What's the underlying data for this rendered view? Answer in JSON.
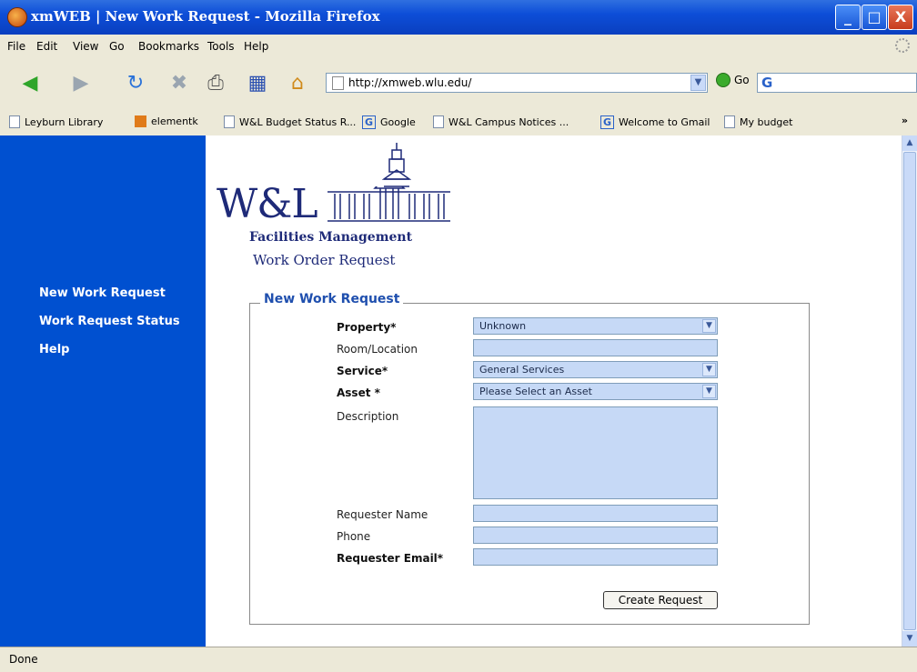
{
  "window": {
    "title": "xmWEB | New Work Request - Mozilla Firefox",
    "minimize_glyph": "_",
    "maximize_glyph": "□",
    "close_glyph": "X"
  },
  "menubar": {
    "items": [
      "File",
      "Edit",
      "View",
      "Go",
      "Bookmarks",
      "Tools",
      "Help"
    ]
  },
  "navbar": {
    "url": "http://xmweb.wlu.edu/",
    "go_label": "Go",
    "icons": [
      "back-icon",
      "forward-icon",
      "reload-icon",
      "stop-icon",
      "print-icon",
      "bookmarks-icon",
      "home-icon"
    ]
  },
  "bookmarks": {
    "items": [
      {
        "label": "Leyburn Library",
        "icon": "page"
      },
      {
        "label": "elementk",
        "icon": "elementk"
      },
      {
        "label": "W&L Budget Status R...",
        "icon": "page"
      },
      {
        "label": "Google",
        "icon": "google"
      },
      {
        "label": "W&L Campus Notices ...",
        "icon": "page"
      },
      {
        "label": "Welcome to Gmail",
        "icon": "google"
      },
      {
        "label": "My budget",
        "icon": "page"
      }
    ],
    "more": "»"
  },
  "sidebar": {
    "links": [
      "New Work Request",
      "Work Request Status",
      "Help"
    ]
  },
  "logo": {
    "wordmark": "W&L",
    "line1": "Facilities Management",
    "line2": "Work Order Request"
  },
  "form": {
    "legend": "New Work Request",
    "property_label": "Property*",
    "property_value": "Unknown",
    "room_label": "Room/Location",
    "service_label": "Service*",
    "service_value": "General Services",
    "asset_label": "Asset *",
    "asset_value": "Please Select an Asset",
    "description_label": "Description",
    "requester_name_label": "Requester Name",
    "phone_label": "Phone",
    "email_label": "Requester Email*",
    "submit_label": "Create Request"
  },
  "status": {
    "text": "Done"
  }
}
